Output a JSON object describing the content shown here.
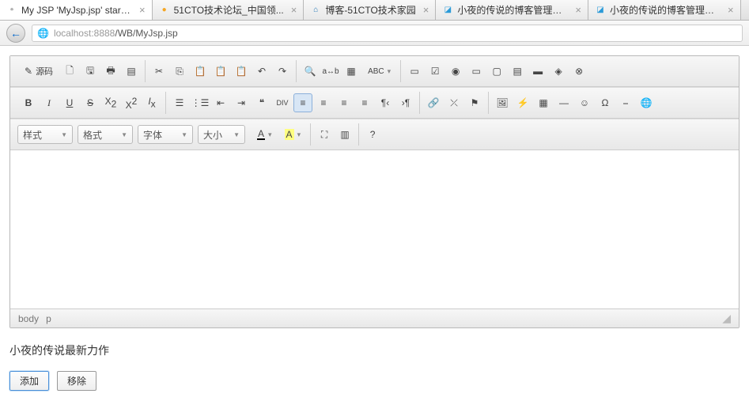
{
  "tabs": [
    {
      "title": "My JSP 'MyJsp.jsp' starti...",
      "icon": "page",
      "active": true
    },
    {
      "title": "51CTO技术论坛_中国领...",
      "icon": "orange"
    },
    {
      "title": "博客-51CTO技术家园",
      "icon": "house"
    },
    {
      "title": "小夜的传说的博客管理后...",
      "icon": "blue"
    },
    {
      "title": "小夜的传说的博客管理后...",
      "icon": "blue"
    }
  ],
  "url": {
    "host": "localhost",
    "port": ":8888",
    "path": "/WB/MyJsp.jsp"
  },
  "toolbar": {
    "source": "源码",
    "combos": {
      "style": "样式",
      "format": "格式",
      "font": "字体",
      "size": "大小"
    }
  },
  "status": {
    "path": [
      "body",
      "p"
    ]
  },
  "after": {
    "text": "小夜的传说最新力作",
    "add": "添加",
    "remove": "移除"
  }
}
